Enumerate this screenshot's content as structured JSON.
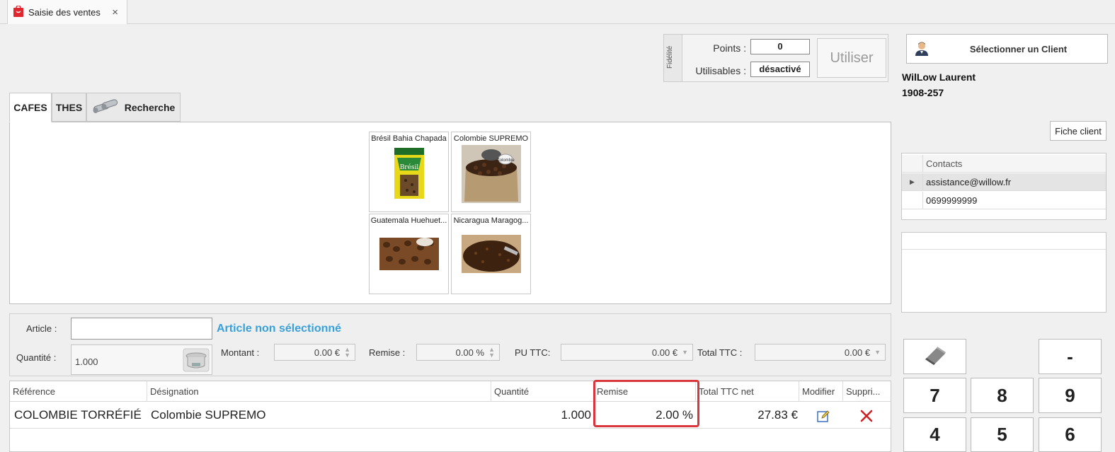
{
  "window": {
    "tab_title": "Saisie des ventes",
    "tab_close": "×"
  },
  "fidelity": {
    "side_label": "Fidélité",
    "points_label": "Points :",
    "points_value": "0",
    "usable_label": "Utilisables :",
    "usable_value": "désactivé",
    "use_button": "Utiliser"
  },
  "client": {
    "select_button": "Sélectionner un Client",
    "name": "WilLow Laurent",
    "code": "1908-257",
    "fiche_button": "Fiche client",
    "contacts_header": "Contacts",
    "contacts": [
      "assistance@willow.fr",
      "0699999999"
    ]
  },
  "categories": {
    "tabs": [
      "CAFES",
      "THES",
      "Recherche"
    ],
    "active": "CAFES"
  },
  "products": [
    {
      "name": "Brésil Bahia Chapada",
      "pack_text": "Brésil"
    },
    {
      "name": "Colombie SUPREMO",
      "pack_text": "Colombie"
    },
    {
      "name": "Guatemala Huehuet..."
    },
    {
      "name": "Nicaragua Maragog..."
    }
  ],
  "article": {
    "article_label": "Article :",
    "article_value": "",
    "status": "Article non sélectionné",
    "quantity_label": "Quantité :",
    "quantity_value": "1.000",
    "montant_label": "Montant :",
    "montant_value": "0.00 €",
    "remise_label": "Remise :",
    "remise_value": "0.00 %",
    "pu_label": "PU TTC:",
    "pu_value": "0.00 €",
    "total_label": "Total TTC :",
    "total_value": "0.00 €"
  },
  "grid": {
    "columns": [
      "Référence",
      "Désignation",
      "Quantité",
      "Remise",
      "Total TTC net",
      "Modifier",
      "Suppri..."
    ],
    "rows": [
      {
        "reference": "COLOMBIE TORRÉFIÉ",
        "designation": "Colombie SUPREMO",
        "quantite": "1.000",
        "remise": "2.00 %",
        "total": "27.83 €"
      }
    ]
  },
  "keypad": {
    "keys": [
      "-",
      "7",
      "8",
      "9",
      "4",
      "5",
      "6"
    ]
  },
  "colors": {
    "highlight": "#d9363e",
    "status_blue": "#3aa0d8",
    "delete_red": "#cc2222"
  }
}
